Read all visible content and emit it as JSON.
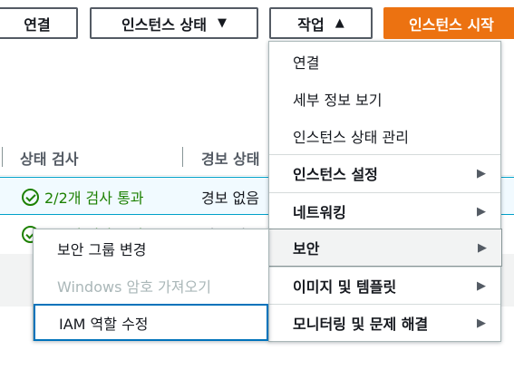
{
  "toolbar": {
    "connect_label": "연결",
    "instance_state_label": "인스턴스 상태",
    "actions_label": "작업",
    "launch_label": "인스턴스 시작",
    "down_arrow": "▼",
    "up_arrow": "▲"
  },
  "table": {
    "columns": [
      "상태 검사",
      "경보 상태"
    ],
    "rows": [
      {
        "status_check": "2/2개 검사 통과",
        "alarm": "경보 없음"
      },
      {
        "status_check": "2/2개 검사 통과",
        "alarm": "경보 없음"
      }
    ]
  },
  "actions_menu": {
    "items": [
      {
        "label": "연결",
        "bold": false,
        "submenu": false
      },
      {
        "label": "세부 정보 보기",
        "bold": false,
        "submenu": false
      },
      {
        "label": "인스턴스 상태 관리",
        "bold": false,
        "submenu": false
      },
      {
        "label": "인스턴스 설정",
        "bold": true,
        "submenu": true
      },
      {
        "label": "네트워킹",
        "bold": true,
        "submenu": true
      },
      {
        "label": "보안",
        "bold": true,
        "submenu": true,
        "active": true
      },
      {
        "label": "이미지 및 템플릿",
        "bold": true,
        "submenu": true
      },
      {
        "label": "모니터링 및 문제 해결",
        "bold": true,
        "submenu": true
      }
    ],
    "caret": "▶"
  },
  "security_submenu": {
    "items": [
      {
        "label": "보안 그룹 변경",
        "disabled": false
      },
      {
        "label": "Windows 암호 가져오기",
        "disabled": true
      },
      {
        "label": "IAM 역할 수정",
        "disabled": false,
        "focused": true
      }
    ]
  },
  "colors": {
    "primary": "#ec7211",
    "success": "#1d8102",
    "focus": "#0073bb"
  }
}
